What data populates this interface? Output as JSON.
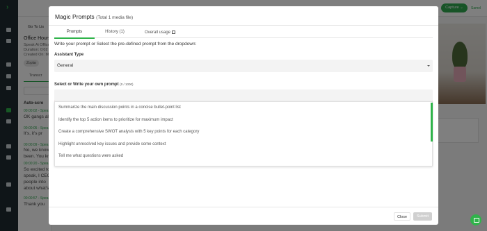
{
  "topbar": {
    "capture_label": "Capture ⌄",
    "user_label": "Samel"
  },
  "leftpanel": {
    "goto_label": "Go To Lis",
    "meeting_title": "Office Hours",
    "meta_lines": [
      "Speak Ai Office",
      "Duration: 0:02",
      "Created On: M"
    ],
    "tag": "Zoplar",
    "transcript_tab": "Transcr",
    "autoscroll_label": "Auto-scro",
    "transcript": [
      {
        "time": "00:00:02 - Spea",
        "text": "OK gangs all"
      },
      {
        "time": "00:00:05 - Spea",
        "text": "It's, it's pr"
      },
      {
        "time": "00:00:09 - Spea",
        "text": "No, we know"
      },
      {
        "time": "",
        "text": "been. You kn"
      },
      {
        "time": "00:00:20 - Spea",
        "text": "So excited to"
      },
      {
        "time": "",
        "text": "speak, I CEO"
      },
      {
        "time": "",
        "text": "people into"
      },
      {
        "time": "",
        "text": "about what's"
      },
      {
        "time": "00:00:57 - Spea",
        "text": "Thank you"
      }
    ]
  },
  "modal": {
    "title": "Magic Prompts",
    "subtitle": "(Total 1 media file)",
    "tabs": [
      "Prompts",
      "History (1)",
      "Overall usage"
    ],
    "instruction": "Write your prompt or Select the pre-defined prompt from the dropdown:",
    "assistant_label": "Assistant Type",
    "assistant_value": "General",
    "prompt_label": "Select or Write your own prompt",
    "prompt_counter": "(0 / 1000)",
    "prompt_value": "",
    "options": [
      "Summarize the main discussion points in a concise bullet-point list",
      "Identify the top 5 action items to prioritize for maximum impact",
      "Create a comprehensive SWOT analysis with 5 key points for each category",
      "Highlight unresolved key issues and provide some context",
      "Tell me what questions were asked"
    ],
    "close_label": "Close",
    "submit_label": "Submit"
  },
  "colors": {
    "accent": "#2fb34a",
    "sidebar": "#1e2a30",
    "error_underline": "#e07b86"
  }
}
